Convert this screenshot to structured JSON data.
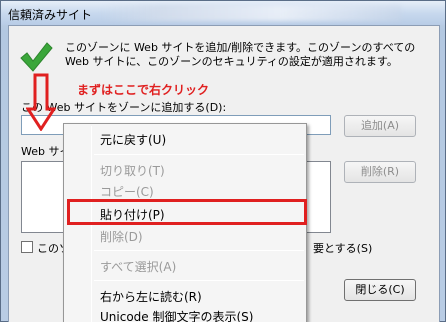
{
  "window": {
    "title": "信頼済みサイト"
  },
  "dialog": {
    "description": "このゾーンに Web サイトを追加/削除できます。このゾーンのすべての Web サイトに、このゾーンのセキュリティの設定が適用されます。",
    "annotation": "まずはここで右クリック",
    "add_label": "この Web サイトをゾーンに追加する(D):",
    "url_value": "",
    "add_button": "追加(A)",
    "sites_label": "Web サイ",
    "remove_button": "削除(R)",
    "https_label_left": "このゾ",
    "https_label_right": "要とする(S)",
    "close_button": "閉じる(C)"
  },
  "context_menu": {
    "items": [
      {
        "label": "元に戻す(U)",
        "enabled": true
      },
      {
        "label": "切り取り(T)",
        "enabled": false
      },
      {
        "label": "コピー(C)",
        "enabled": false
      },
      {
        "label": "貼り付け(P)",
        "enabled": true,
        "highlighted": true
      },
      {
        "label": "削除(D)",
        "enabled": false
      },
      {
        "label": "すべて選択(A)",
        "enabled": false
      },
      {
        "label": "右から左に読む(R)",
        "enabled": true
      },
      {
        "label": "Unicode 制御文字の表示(S)",
        "enabled": true
      }
    ]
  },
  "colors": {
    "annotation": "#e02020",
    "check": "#3aa63a"
  },
  "icons": {
    "check": "check-icon",
    "arrow": "down-arrow-icon"
  }
}
